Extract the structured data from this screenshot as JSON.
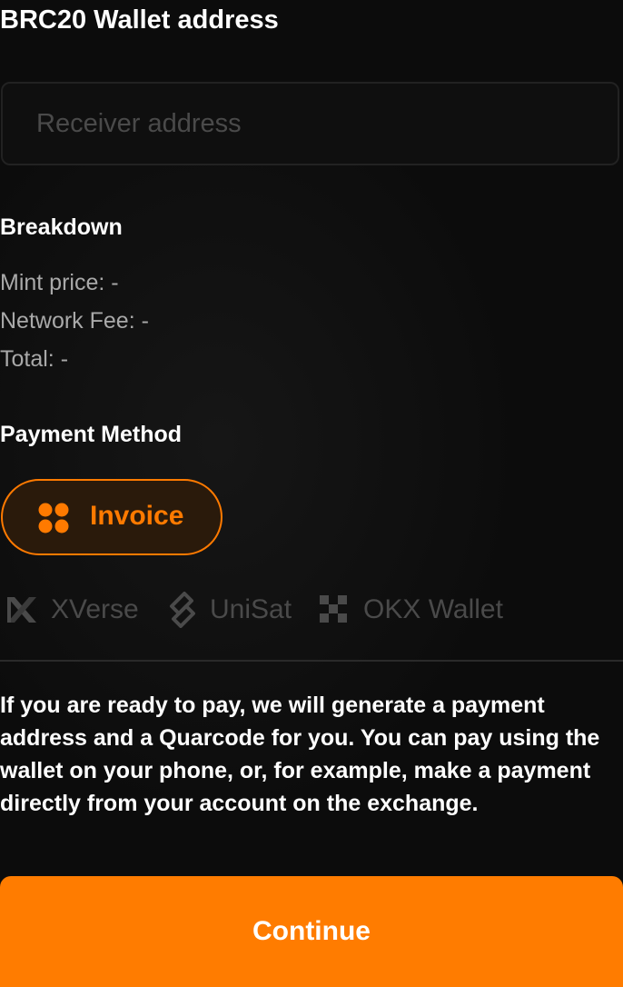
{
  "wallet_address": {
    "title": "BRC20 Wallet address",
    "input_value": "",
    "placeholder": "Receiver address"
  },
  "breakdown": {
    "heading": "Breakdown",
    "mint_price": "Mint price: -",
    "network_fee": "Network Fee: -",
    "total": "Total: -"
  },
  "payment_method": {
    "heading": "Payment Method",
    "selected": {
      "label": "Invoice",
      "icon": "grid-dots-icon"
    },
    "wallets": [
      {
        "label": "XVerse",
        "icon": "xverse-x-icon"
      },
      {
        "label": "UniSat",
        "icon": "unisat-icon"
      },
      {
        "label": "OKX Wallet",
        "icon": "okx-checker-icon"
      }
    ]
  },
  "info_text": "If you are ready to pay, we will generate a payment address and a Quarcode for you. You can pay using the wallet on your phone, or, for example, make a payment directly from your account on the exchange.",
  "continue_label": "Continue",
  "colors": {
    "accent": "#ff7c00",
    "background": "#0c0c0c",
    "muted_text": "#a9a9a9",
    "disabled": "#4a4a4a"
  }
}
